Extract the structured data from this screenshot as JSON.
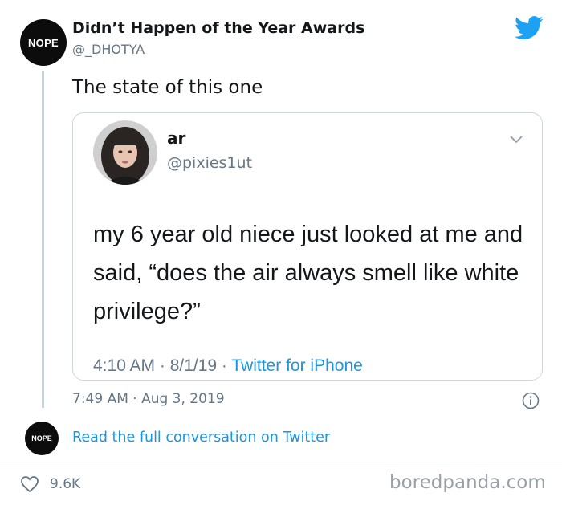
{
  "tweet": {
    "author_avatar_text": "NOPE",
    "author_name": "Didn’t Happen of the Year Awards",
    "author_handle": "@_DHOTYA",
    "text": "The state of this one",
    "timestamp": "7:49 AM · Aug 3, 2019",
    "read_full": "Read the full conversation on Twitter",
    "small_avatar_text": "NOPE",
    "likes": "9.6K"
  },
  "quoted": {
    "name": "ar",
    "handle": "@pixies1ut",
    "body": "my 6 year old niece just looked at me and said, “does the air always smell like white privilege?”",
    "time": "4:10 AM · 8/1/19 · ",
    "source": "Twitter for iPhone"
  },
  "watermark": "boredpanda.com",
  "colors": {
    "link_blue": "#1b95e0",
    "secondary_text": "#657786",
    "twitter_blue": "#1da1f2"
  },
  "icons": [
    "twitter-bird-icon",
    "chevron-down-icon",
    "info-icon",
    "heart-icon"
  ]
}
